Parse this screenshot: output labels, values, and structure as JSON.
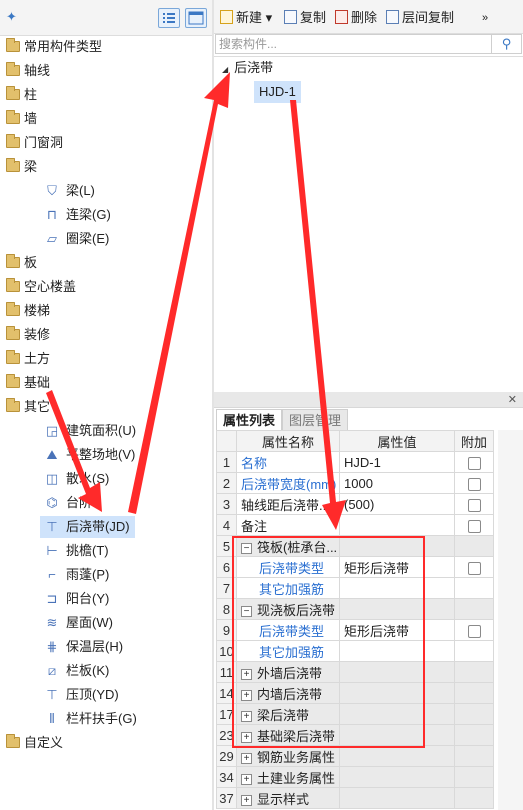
{
  "left_panel": {
    "tree": [
      {
        "label": "常用构件类型",
        "icon": "folder-icon"
      },
      {
        "label": "轴线",
        "icon": "folder-icon"
      },
      {
        "label": "柱",
        "icon": "folder-icon"
      },
      {
        "label": "墙",
        "icon": "folder-icon"
      },
      {
        "label": "门窗洞",
        "icon": "folder-icon"
      },
      {
        "label": "梁",
        "icon": "folder-open-icon"
      },
      {
        "label": "梁(L)",
        "icon": "beam-icon"
      },
      {
        "label": "连梁(G)",
        "icon": "link-beam-icon"
      },
      {
        "label": "圈梁(E)",
        "icon": "ring-beam-icon"
      },
      {
        "label": "板",
        "icon": "folder-icon"
      },
      {
        "label": "空心楼盖",
        "icon": "folder-icon"
      },
      {
        "label": "楼梯",
        "icon": "folder-icon"
      },
      {
        "label": "装修",
        "icon": "folder-icon"
      },
      {
        "label": "土方",
        "icon": "folder-icon"
      },
      {
        "label": "基础",
        "icon": "folder-icon"
      },
      {
        "label": "其它",
        "icon": "folder-open-icon"
      },
      {
        "label": "建筑面积(U)",
        "icon": "area-icon"
      },
      {
        "label": "平整场地(V)",
        "icon": "site-icon"
      },
      {
        "label": "散水(S)",
        "icon": "apron-icon"
      },
      {
        "label": "台阶",
        "icon": "step-icon"
      },
      {
        "label": "后浇带(JD)",
        "icon": "post-pour-icon"
      },
      {
        "label": "挑檐(T)",
        "icon": "eave-icon"
      },
      {
        "label": "雨蓬(P)",
        "icon": "canopy-icon"
      },
      {
        "label": "阳台(Y)",
        "icon": "balcony-icon"
      },
      {
        "label": "屋面(W)",
        "icon": "roof-icon"
      },
      {
        "label": "保温层(H)",
        "icon": "insulation-icon"
      },
      {
        "label": "栏板(K)",
        "icon": "parapet-icon"
      },
      {
        "label": "压顶(YD)",
        "icon": "coping-icon"
      },
      {
        "label": "栏杆扶手(G)",
        "icon": "railing-icon"
      },
      {
        "label": "自定义",
        "icon": "folder-icon"
      }
    ]
  },
  "toolbar": {
    "new_label": "新建",
    "copy_label": "复制",
    "delete_label": "删除",
    "floor_copy_label": "层间复制",
    "more_label": "»"
  },
  "search": {
    "placeholder": "搜索构件..."
  },
  "component_tree": {
    "root_label": "后浇带",
    "child_label": "HJD-1"
  },
  "properties": {
    "tabs": [
      "属性列表",
      "图层管理"
    ],
    "headers": [
      "属性名称",
      "属性值",
      "附加"
    ],
    "rows": [
      {
        "num": "1",
        "name": "名称",
        "value": "HJD-1"
      },
      {
        "num": "2",
        "name": "后浇带宽度(mm)",
        "value": "1000"
      },
      {
        "num": "3",
        "name": "轴线距后浇带...",
        "value": "(500)"
      },
      {
        "num": "4",
        "name": "备注",
        "value": ""
      },
      {
        "num": "5",
        "name": "筏板(桩承台...",
        "value": ""
      },
      {
        "num": "6",
        "name": "后浇带类型",
        "value": "矩形后浇带"
      },
      {
        "num": "7",
        "name": "其它加强筋",
        "value": ""
      },
      {
        "num": "8",
        "name": "现浇板后浇带",
        "value": ""
      },
      {
        "num": "9",
        "name": "后浇带类型",
        "value": "矩形后浇带"
      },
      {
        "num": "10",
        "name": "其它加强筋",
        "value": ""
      },
      {
        "num": "11",
        "name": "外墙后浇带",
        "value": ""
      },
      {
        "num": "14",
        "name": "内墙后浇带",
        "value": ""
      },
      {
        "num": "17",
        "name": "梁后浇带",
        "value": ""
      },
      {
        "num": "23",
        "name": "基础梁后浇带",
        "value": ""
      },
      {
        "num": "29",
        "name": "钢筋业务属性",
        "value": ""
      },
      {
        "num": "34",
        "name": "土建业务属性",
        "value": ""
      },
      {
        "num": "37",
        "name": "显示样式",
        "value": ""
      }
    ]
  },
  "colors": {
    "accent": "#2a6fd1",
    "selection": "#cfe3fb",
    "annotation": "#ff2a2a"
  }
}
